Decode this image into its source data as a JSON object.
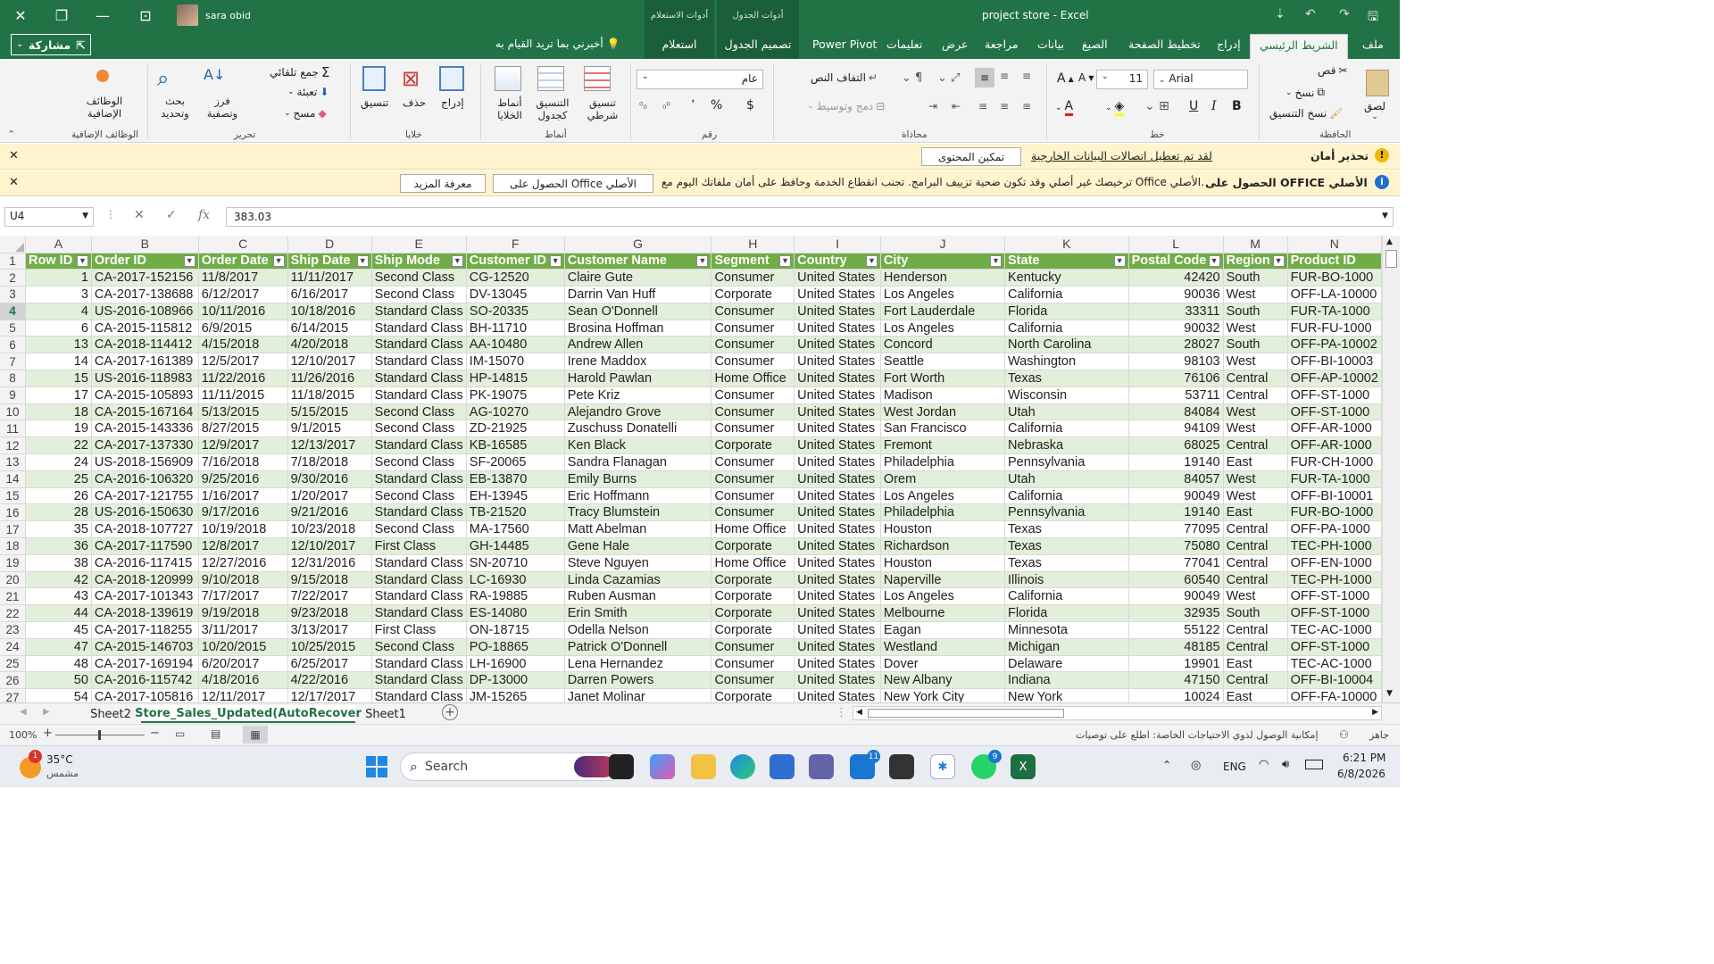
{
  "window": {
    "title": "project store",
    "app_name": "Excel",
    "user_name": "sara obid",
    "context_tab_table_tools": "أدوات الجدول",
    "context_tab_query_tools": "أدوات الاستعلام"
  },
  "tabs": {
    "file": "ملف",
    "home": "الشريط الرئيسي",
    "insert": "إدراج",
    "page_layout": "تخطيط الصفحة",
    "formulas": "الصيغ",
    "data": "بيانات",
    "review": "مراجعة",
    "view": "عرض",
    "help": "تعليمات",
    "power_pivot": "Power Pivot",
    "table_design": "تصميم الجدول",
    "query": "استعلام",
    "tell_me": "أخبرني بما تريد القيام به",
    "share": "مشاركة"
  },
  "ribbon": {
    "clipboard": {
      "label": "الحافظة",
      "paste": "لصق",
      "cut": "قص",
      "copy": "نسخ",
      "format_painter": "نسخ التنسيق"
    },
    "font": {
      "label": "خط",
      "name": "Arial",
      "size": "11"
    },
    "alignment": {
      "label": "محاذاة",
      "wrap_text": "التفاف النص",
      "merge": "دمج وتوسيط"
    },
    "number": {
      "label": "رقم",
      "format": "عام",
      "currency": "$",
      "percent": "%",
      "comma": "٬",
      "inc_dec": "⁰⁰"
    },
    "styles": {
      "label": "أنماط",
      "conditional": "تنسيق شرطي",
      "format_table": "التنسيق كجدول",
      "cell_styles": "أنماط الخلايا"
    },
    "cells": {
      "label": "خلايا",
      "insert": "إدراج",
      "delete": "حذف",
      "format": "تنسيق"
    },
    "editing": {
      "label": "تحرير",
      "autosum": "جمع تلقائي",
      "fill": "تعبئة",
      "clear": "مسح",
      "sort": "فرز وتصفية",
      "find": "بحث وتحديد"
    },
    "addins": {
      "label": "الوظائف الإضافية",
      "button": "الوظائف الإضافية"
    }
  },
  "security_bar": {
    "title": "تحذير أمان",
    "message": "لقد تم تعطيل اتصالات البيانات الخارجية",
    "button": "تمكين المحتوى"
  },
  "office_bar": {
    "title": "الحصول على OFFICE الأصلي",
    "message": "ترخيصك غير أصلي وقد تكون ضحية تزييف البرامج. تجنب انقطاع الخدمة وحافظ على أمان ملفاتك اليوم مع Office الأصلي.",
    "button_get": "الحصول على Office الأصلي",
    "button_learn": "معرفة المزيد"
  },
  "formula_bar": {
    "name_box": "U4",
    "value": "383.03",
    "fx": "fx"
  },
  "columns": [
    "A",
    "B",
    "C",
    "D",
    "E",
    "F",
    "G",
    "H",
    "I",
    "J",
    "K",
    "L",
    "M",
    "N"
  ],
  "table_headers": [
    "Row ID",
    "Order ID",
    "Order Date",
    "Ship Date",
    "Ship Mode",
    "Customer ID",
    "Customer Name",
    "Segment",
    "Country",
    "City",
    "State",
    "Postal Code",
    "Region",
    "Product ID"
  ],
  "rows": [
    [
      "2",
      "1",
      "CA-2017-152156",
      "11/8/2017",
      "11/11/2017",
      "Second Class",
      "CG-12520",
      "Claire Gute",
      "Consumer",
      "United States",
      "Henderson",
      "Kentucky",
      "42420",
      "South",
      "FUR-BO-1000"
    ],
    [
      "3",
      "3",
      "CA-2017-138688",
      "6/12/2017",
      "6/16/2017",
      "Second Class",
      "DV-13045",
      "Darrin Van Huff",
      "Corporate",
      "United States",
      "Los Angeles",
      "California",
      "90036",
      "West",
      "OFF-LA-10000"
    ],
    [
      "4",
      "4",
      "US-2016-108966",
      "10/11/2016",
      "10/18/2016",
      "Standard Class",
      "SO-20335",
      "Sean O'Donnell",
      "Consumer",
      "United States",
      "Fort Lauderdale",
      "Florida",
      "33311",
      "South",
      "FUR-TA-1000"
    ],
    [
      "5",
      "6",
      "CA-2015-115812",
      "6/9/2015",
      "6/14/2015",
      "Standard Class",
      "BH-11710",
      "Brosina Hoffman",
      "Consumer",
      "United States",
      "Los Angeles",
      "California",
      "90032",
      "West",
      "FUR-FU-1000"
    ],
    [
      "6",
      "13",
      "CA-2018-114412",
      "4/15/2018",
      "4/20/2018",
      "Standard Class",
      "AA-10480",
      "Andrew Allen",
      "Consumer",
      "United States",
      "Concord",
      "North Carolina",
      "28027",
      "South",
      "OFF-PA-10002"
    ],
    [
      "7",
      "14",
      "CA-2017-161389",
      "12/5/2017",
      "12/10/2017",
      "Standard Class",
      "IM-15070",
      "Irene Maddox",
      "Consumer",
      "United States",
      "Seattle",
      "Washington",
      "98103",
      "West",
      "OFF-BI-10003"
    ],
    [
      "8",
      "15",
      "US-2016-118983",
      "11/22/2016",
      "11/26/2016",
      "Standard Class",
      "HP-14815",
      "Harold Pawlan",
      "Home Office",
      "United States",
      "Fort Worth",
      "Texas",
      "76106",
      "Central",
      "OFF-AP-10002"
    ],
    [
      "9",
      "17",
      "CA-2015-105893",
      "11/11/2015",
      "11/18/2015",
      "Standard Class",
      "PK-19075",
      "Pete Kriz",
      "Consumer",
      "United States",
      "Madison",
      "Wisconsin",
      "53711",
      "Central",
      "OFF-ST-1000"
    ],
    [
      "10",
      "18",
      "CA-2015-167164",
      "5/13/2015",
      "5/15/2015",
      "Second Class",
      "AG-10270",
      "Alejandro Grove",
      "Consumer",
      "United States",
      "West Jordan",
      "Utah",
      "84084",
      "West",
      "OFF-ST-1000"
    ],
    [
      "11",
      "19",
      "CA-2015-143336",
      "8/27/2015",
      "9/1/2015",
      "Second Class",
      "ZD-21925",
      "Zuschuss Donatelli",
      "Consumer",
      "United States",
      "San Francisco",
      "California",
      "94109",
      "West",
      "OFF-AR-1000"
    ],
    [
      "12",
      "22",
      "CA-2017-137330",
      "12/9/2017",
      "12/13/2017",
      "Standard Class",
      "KB-16585",
      "Ken Black",
      "Corporate",
      "United States",
      "Fremont",
      "Nebraska",
      "68025",
      "Central",
      "OFF-AR-1000"
    ],
    [
      "13",
      "24",
      "US-2018-156909",
      "7/16/2018",
      "7/18/2018",
      "Second Class",
      "SF-20065",
      "Sandra Flanagan",
      "Consumer",
      "United States",
      "Philadelphia",
      "Pennsylvania",
      "19140",
      "East",
      "FUR-CH-1000"
    ],
    [
      "14",
      "25",
      "CA-2016-106320",
      "9/25/2016",
      "9/30/2016",
      "Standard Class",
      "EB-13870",
      "Emily Burns",
      "Consumer",
      "United States",
      "Orem",
      "Utah",
      "84057",
      "West",
      "FUR-TA-1000"
    ],
    [
      "15",
      "26",
      "CA-2017-121755",
      "1/16/2017",
      "1/20/2017",
      "Second Class",
      "EH-13945",
      "Eric Hoffmann",
      "Consumer",
      "United States",
      "Los Angeles",
      "California",
      "90049",
      "West",
      "OFF-BI-10001"
    ],
    [
      "16",
      "28",
      "US-2016-150630",
      "9/17/2016",
      "9/21/2016",
      "Standard Class",
      "TB-21520",
      "Tracy Blumstein",
      "Consumer",
      "United States",
      "Philadelphia",
      "Pennsylvania",
      "19140",
      "East",
      "FUR-BO-1000"
    ],
    [
      "17",
      "35",
      "CA-2018-107727",
      "10/19/2018",
      "10/23/2018",
      "Second Class",
      "MA-17560",
      "Matt Abelman",
      "Home Office",
      "United States",
      "Houston",
      "Texas",
      "77095",
      "Central",
      "OFF-PA-1000"
    ],
    [
      "18",
      "36",
      "CA-2017-117590",
      "12/8/2017",
      "12/10/2017",
      "First Class",
      "GH-14485",
      "Gene Hale",
      "Corporate",
      "United States",
      "Richardson",
      "Texas",
      "75080",
      "Central",
      "TEC-PH-1000"
    ],
    [
      "19",
      "38",
      "CA-2016-117415",
      "12/27/2016",
      "12/31/2016",
      "Standard Class",
      "SN-20710",
      "Steve Nguyen",
      "Home Office",
      "United States",
      "Houston",
      "Texas",
      "77041",
      "Central",
      "OFF-EN-1000"
    ],
    [
      "20",
      "42",
      "CA-2018-120999",
      "9/10/2018",
      "9/15/2018",
      "Standard Class",
      "LC-16930",
      "Linda Cazamias",
      "Corporate",
      "United States",
      "Naperville",
      "Illinois",
      "60540",
      "Central",
      "TEC-PH-1000"
    ],
    [
      "21",
      "43",
      "CA-2017-101343",
      "7/17/2017",
      "7/22/2017",
      "Standard Class",
      "RA-19885",
      "Ruben Ausman",
      "Corporate",
      "United States",
      "Los Angeles",
      "California",
      "90049",
      "West",
      "OFF-ST-1000"
    ],
    [
      "22",
      "44",
      "CA-2018-139619",
      "9/19/2018",
      "9/23/2018",
      "Standard Class",
      "ES-14080",
      "Erin Smith",
      "Corporate",
      "United States",
      "Melbourne",
      "Florida",
      "32935",
      "South",
      "OFF-ST-1000"
    ],
    [
      "23",
      "45",
      "CA-2017-118255",
      "3/11/2017",
      "3/13/2017",
      "First Class",
      "ON-18715",
      "Odella Nelson",
      "Corporate",
      "United States",
      "Eagan",
      "Minnesota",
      "55122",
      "Central",
      "TEC-AC-1000"
    ],
    [
      "24",
      "47",
      "CA-2015-146703",
      "10/20/2015",
      "10/25/2015",
      "Second Class",
      "PO-18865",
      "Patrick O'Donnell",
      "Consumer",
      "United States",
      "Westland",
      "Michigan",
      "48185",
      "Central",
      "OFF-ST-1000"
    ],
    [
      "25",
      "48",
      "CA-2017-169194",
      "6/20/2017",
      "6/25/2017",
      "Standard Class",
      "LH-16900",
      "Lena Hernandez",
      "Consumer",
      "United States",
      "Dover",
      "Delaware",
      "19901",
      "East",
      "TEC-AC-1000"
    ],
    [
      "26",
      "50",
      "CA-2016-115742",
      "4/18/2016",
      "4/22/2016",
      "Standard Class",
      "DP-13000",
      "Darren Powers",
      "Consumer",
      "United States",
      "New Albany",
      "Indiana",
      "47150",
      "Central",
      "OFF-BI-10004"
    ],
    [
      "27",
      "54",
      "CA-2017-105816",
      "12/11/2017",
      "12/17/2017",
      "Standard Class",
      "JM-15265",
      "Janet Molinar",
      "Corporate",
      "United States",
      "New York City",
      "New York",
      "10024",
      "East",
      "OFF-FA-10000"
    ]
  ],
  "sheet_tabs": [
    "Sheet2",
    "Store_Sales_Updated(AutoRecover",
    "Sheet1"
  ],
  "active_sheet": "Store_Sales_Updated(AutoRecover",
  "status": {
    "ready": "جاهز",
    "accessibility": "إمكانية الوصول لذوي الاحتياجات الخاصة: اطلع على توصيات",
    "zoom": "100%"
  },
  "taskbar": {
    "weather_temp": "35°C",
    "weather_desc": "مشمس",
    "search": "Search",
    "lang": "ENG",
    "time": "6:21 PM",
    "date": "6/8/2026",
    "teams_badge": "11",
    "whatsapp_badge": "9",
    "weather_badge": "1"
  }
}
